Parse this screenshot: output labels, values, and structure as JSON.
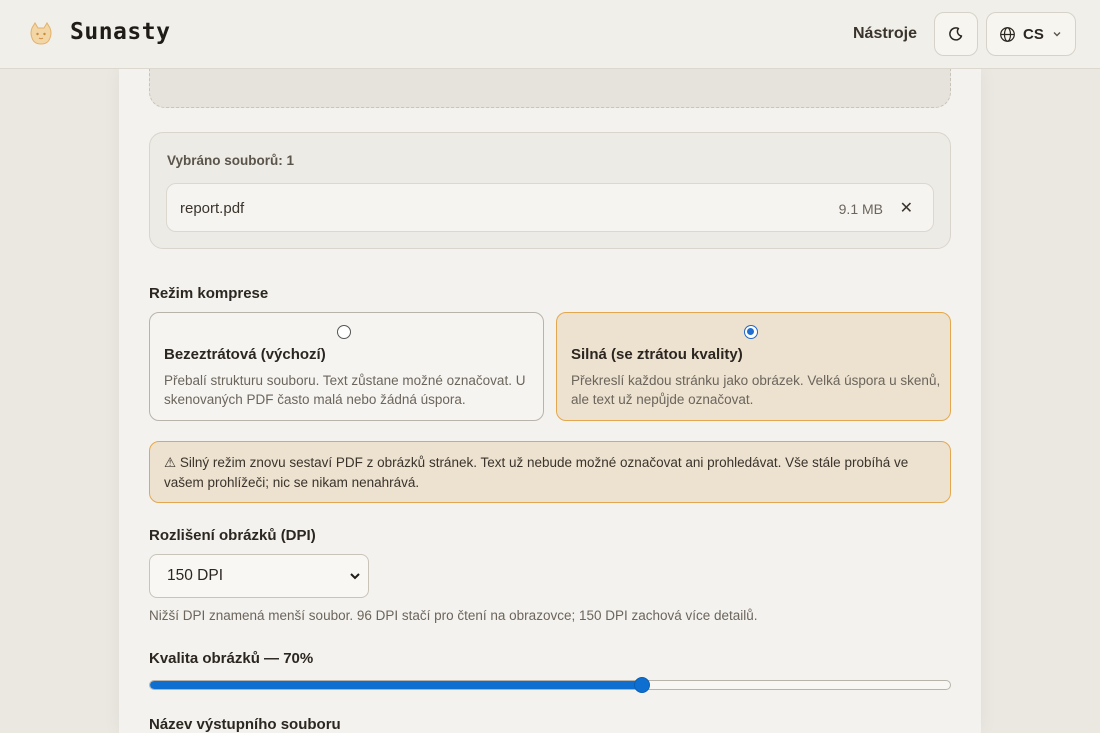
{
  "header": {
    "brand": "Sunasty",
    "nav_tools": "Nástroje",
    "language_code": "CS",
    "logo_icon": "cat-logo-icon",
    "theme_icon": "moon-icon",
    "language_icon": "globe-icon"
  },
  "files": {
    "count_label": "Vybráno souborů: 1",
    "items": [
      {
        "name": "report.pdf",
        "size": "9.1 MB",
        "remove": "✕"
      }
    ]
  },
  "compression": {
    "label": "Režim komprese",
    "modes": [
      {
        "title": "Bezeztrátová (výchozí)",
        "description": "Přebalí strukturu souboru. Text zůstane možné označovat. U skenovaných PDF často malá nebo žádná úspora.",
        "selected": false
      },
      {
        "title": "Silná (se ztrátou kvality)",
        "description": "Překreslí každou stránku jako obrázek. Velká úspora u skenů, ale text už nepůjde označovat.",
        "selected": true
      }
    ],
    "warning": "⚠ Silný režim znovu sestaví PDF z obrázků stránek. Text už nebude možné označovat ani prohledávat. Vše stále probíhá ve vašem prohlížeči; nic se nikam nenahrává."
  },
  "dpi": {
    "label": "Rozlišení obrázků (DPI)",
    "selected": "150 DPI",
    "hint": "Nižší DPI znamená menší soubor. 96 DPI stačí pro čtení na obrazovce; 150 DPI zachová více detailů."
  },
  "quality": {
    "label": "Kvalita obrázků — 70%",
    "fraction": 0.615
  },
  "output": {
    "label": "Název výstupního souboru"
  },
  "colors": {
    "accent": "#0f6fd0",
    "warning_border": "#e3a84f",
    "warning_bg": "#ede1cf"
  }
}
